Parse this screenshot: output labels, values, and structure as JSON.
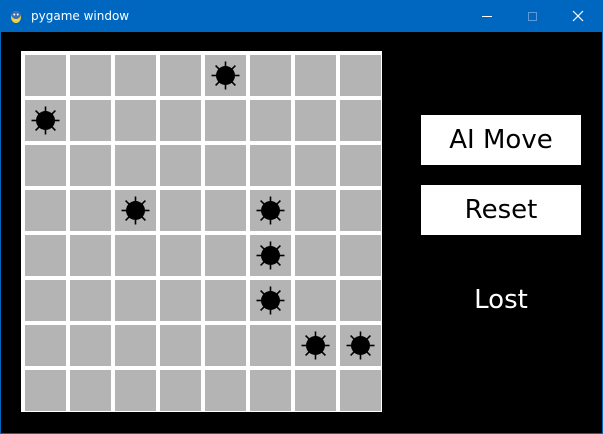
{
  "window": {
    "title": "pygame window",
    "titlebar_color": "#0067c0",
    "buttons": {
      "minimize_icon": "minimize-icon",
      "maximize_icon": "maximize-icon",
      "close_icon": "close-icon"
    }
  },
  "board": {
    "rows": 8,
    "cols": 8,
    "cell_color": "#b4b4b4",
    "grid_color": "#ffffff",
    "mines": [
      [
        0,
        4
      ],
      [
        1,
        0
      ],
      [
        3,
        2
      ],
      [
        3,
        5
      ],
      [
        4,
        5
      ],
      [
        5,
        5
      ],
      [
        6,
        6
      ],
      [
        6,
        7
      ]
    ]
  },
  "panel": {
    "ai_move_label": "AI Move",
    "reset_label": "Reset",
    "status_text": "Lost"
  }
}
